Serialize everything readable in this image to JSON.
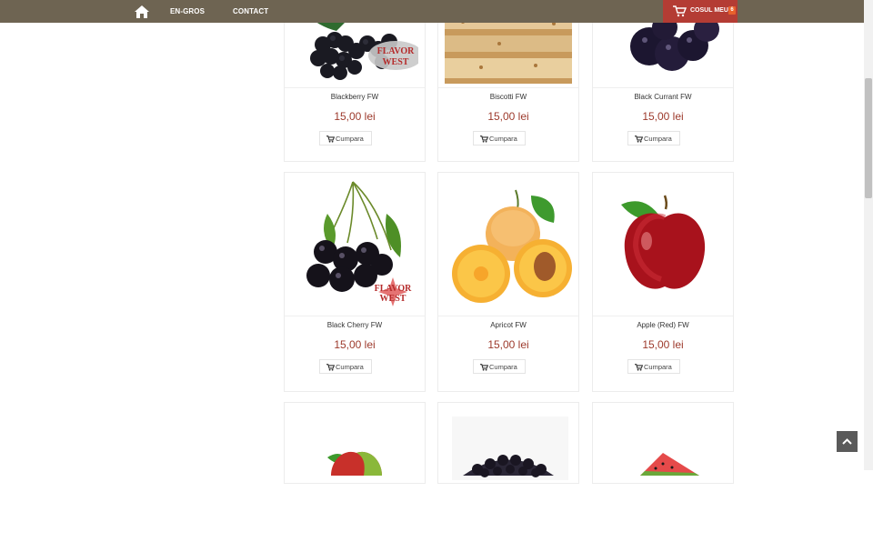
{
  "nav": {
    "home_icon": "home-icon",
    "links": [
      "EN-GROS",
      "CONTACT"
    ],
    "cart_label": "COSUL MEU",
    "cart_count": "6"
  },
  "colors": {
    "topbar": "#6e6452",
    "cart": "#b43c34",
    "cart_badge": "#e8612c",
    "price": "#9d3a2c"
  },
  "products": [
    {
      "name": "Blackberry FW",
      "price": "15,00 lei",
      "button": "Cumpara"
    },
    {
      "name": "Biscotti FW",
      "price": "15,00 lei",
      "button": "Cumpara"
    },
    {
      "name": "Black Currant FW",
      "price": "15,00 lei",
      "button": "Cumpara"
    },
    {
      "name": "Black Cherry FW",
      "price": "15,00 lei",
      "button": "Cumpara"
    },
    {
      "name": "Apricot FW",
      "price": "15,00 lei",
      "button": "Cumpara"
    },
    {
      "name": "Apple (Red) FW",
      "price": "15,00 lei",
      "button": "Cumpara"
    }
  ],
  "brand_mark": "FLAVOR WEST"
}
